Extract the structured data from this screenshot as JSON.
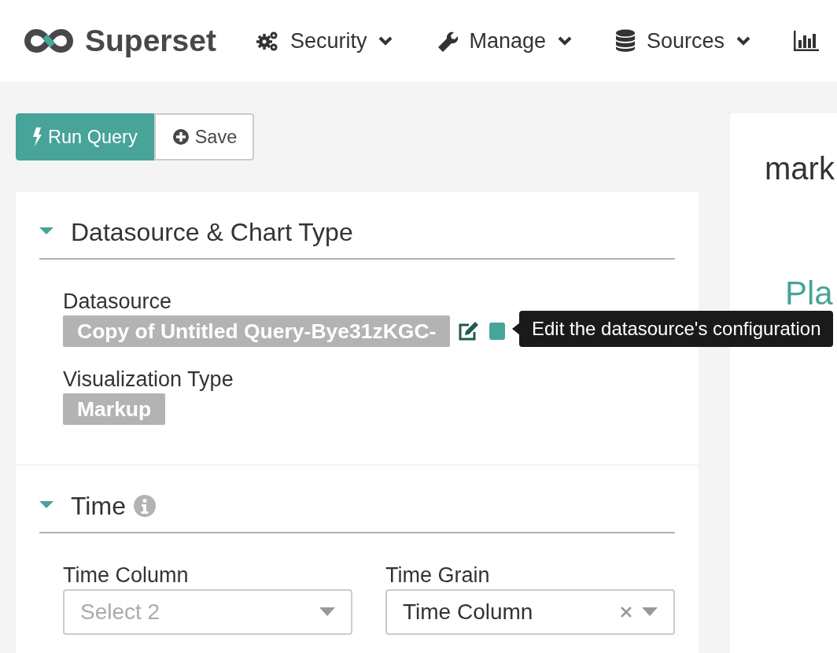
{
  "brand": {
    "name": "Superset"
  },
  "nav": [
    {
      "kind": "gears",
      "label": "Security"
    },
    {
      "kind": "wrench",
      "label": "Manage"
    },
    {
      "kind": "database",
      "label": "Sources"
    },
    {
      "kind": "chart"
    }
  ],
  "toolbar": [
    {
      "kind": "primary",
      "label": "Run Query"
    },
    {
      "kind": "default",
      "label": "Save"
    }
  ],
  "sections": [
    {
      "title": "Datasource & Chart Type",
      "expanded": true,
      "controls": [
        {
          "kind": "tag",
          "label": "Datasource",
          "value": "Copy of Untitled Query-Bye31zKGC-",
          "actions": true
        },
        {
          "kind": "tag",
          "label": "Visualization Type",
          "value": "Markup"
        }
      ]
    },
    {
      "title": "Time",
      "expanded": true,
      "info": true,
      "controls": [
        {
          "kind": "select",
          "label": "Time Column",
          "placeholder": "Select 2"
        },
        {
          "kind": "select",
          "label": "Time Grain",
          "value": "Time Column",
          "clearable": true
        }
      ]
    }
  ],
  "tooltip": {
    "text": "Edit the datasource's configuration"
  },
  "chart_panel": {
    "title": "mark",
    "text": "Pla"
  }
}
